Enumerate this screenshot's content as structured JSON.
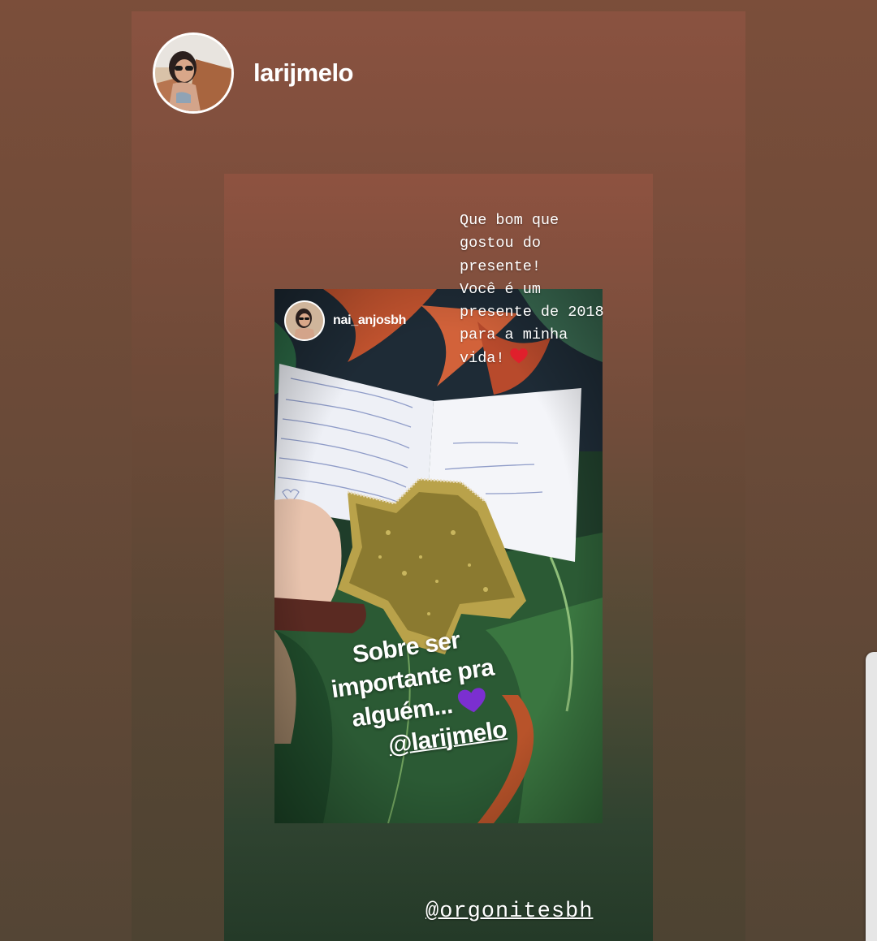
{
  "story": {
    "username": "larijmelo",
    "avatar_icon": "profile-photo-icon"
  },
  "shared_story": {
    "username": "nai_anjosbh",
    "avatar_icon": "profile-photo-icon",
    "message": "Que bom que\ngostou do\npresente!\nVocê é um\npresente de 2018\npara a minha\nvida!",
    "message_emoji": "red-heart-icon",
    "photo_caption": {
      "line1": "Sobre ser",
      "line2": "importante pra",
      "line3": "alguém...",
      "line4": "@larijmelo",
      "emoji": "purple-heart-icon"
    },
    "card_handwriting": {
      "right_line1": "Feliz Natal e",
      "right_line2": "Próspero Ano Novo!",
      "right_line3": "Larissa"
    },
    "mention_bottom": "@orgonitesbh"
  },
  "colors": {
    "background": "#6a4a38",
    "text": "#ffffff",
    "heart_red": "#e0202c",
    "heart_purple": "#7b2fd0"
  }
}
